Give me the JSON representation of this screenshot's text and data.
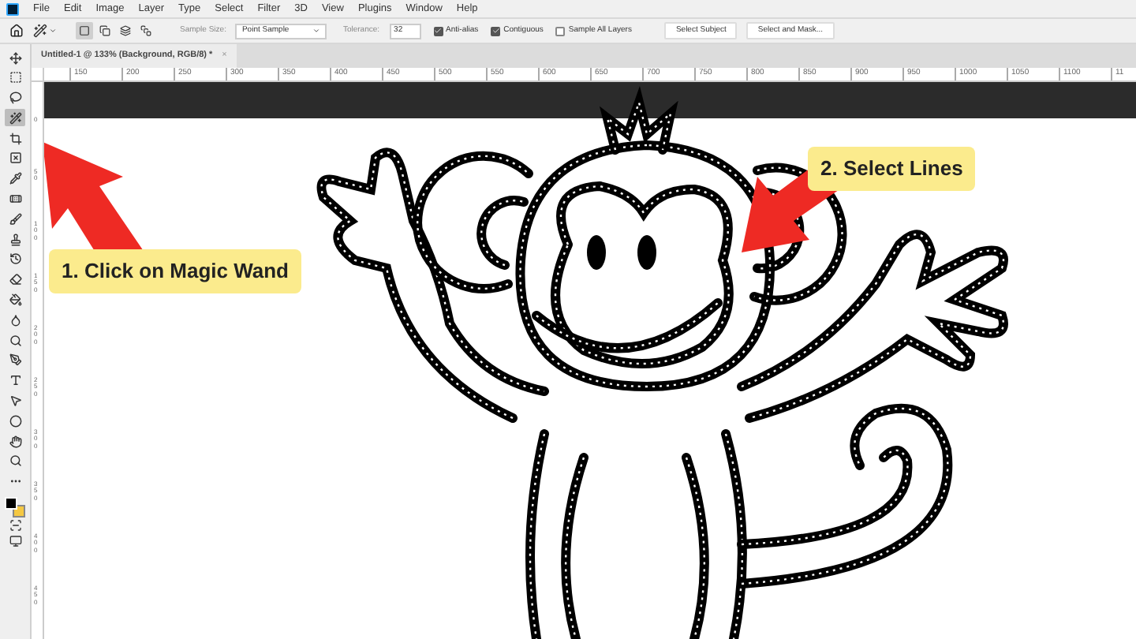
{
  "menu_bar": {
    "items": [
      "File",
      "Edit",
      "Image",
      "Layer",
      "Type",
      "Select",
      "Filter",
      "3D",
      "View",
      "Plugins",
      "Window",
      "Help"
    ]
  },
  "options_bar": {
    "selection_modes": [
      {
        "selected": true
      },
      {
        "selected": false
      },
      {
        "selected": false
      },
      {
        "selected": false
      }
    ],
    "sample_size": {
      "label": "Sample Size:",
      "value": "Point Sample"
    },
    "tolerance": {
      "label": "Tolerance:",
      "value": "32"
    },
    "checkboxes": [
      {
        "label": "Anti-alias",
        "checked": true
      },
      {
        "label": "Contiguous",
        "checked": true
      },
      {
        "label": "Sample All Layers",
        "checked": false
      }
    ],
    "buttons": [
      "Select Subject",
      "Select and Mask..."
    ]
  },
  "document_tab": {
    "title": "Untitled-1 @ 133% (Background, RGB/8) *",
    "close": "×"
  },
  "horizontal_ruler": [
    "150",
    "200",
    "250",
    "300",
    "350",
    "400",
    "450",
    "500",
    "550",
    "600",
    "650",
    "700",
    "750",
    "800",
    "850",
    "900",
    "950",
    "1000",
    "1050",
    "1100",
    "11"
  ],
  "vertical_ruler": [
    "0",
    "50",
    "100",
    "150",
    "200",
    "250",
    "300",
    "350",
    "400",
    "450"
  ],
  "toolbar": {
    "tools": [
      {
        "kind": "move",
        "selected": false
      },
      {
        "kind": "marquee",
        "selected": false
      },
      {
        "kind": "lasso",
        "selected": false
      },
      {
        "kind": "wand",
        "selected": true
      },
      {
        "kind": "crop",
        "selected": false
      },
      {
        "kind": "frame",
        "selected": false
      },
      {
        "kind": "eyedropper",
        "selected": false
      },
      {
        "kind": "healing",
        "selected": false
      },
      {
        "kind": "brush",
        "selected": false
      },
      {
        "kind": "stamp",
        "selected": false
      },
      {
        "kind": "history",
        "selected": false
      },
      {
        "kind": "eraser",
        "selected": false
      },
      {
        "kind": "bucket",
        "selected": false
      },
      {
        "kind": "blur",
        "selected": false
      },
      {
        "kind": "dodge",
        "selected": false
      },
      {
        "kind": "pen",
        "selected": false
      },
      {
        "kind": "type",
        "selected": false
      },
      {
        "kind": "path",
        "selected": false
      },
      {
        "kind": "ellipse",
        "selected": false
      },
      {
        "kind": "hand",
        "selected": false
      },
      {
        "kind": "zoom",
        "selected": false
      },
      {
        "kind": "more",
        "selected": false
      }
    ]
  },
  "callouts": [
    {
      "text": "1. Click on Magic Wand"
    },
    {
      "text": "2. Select Lines"
    }
  ]
}
